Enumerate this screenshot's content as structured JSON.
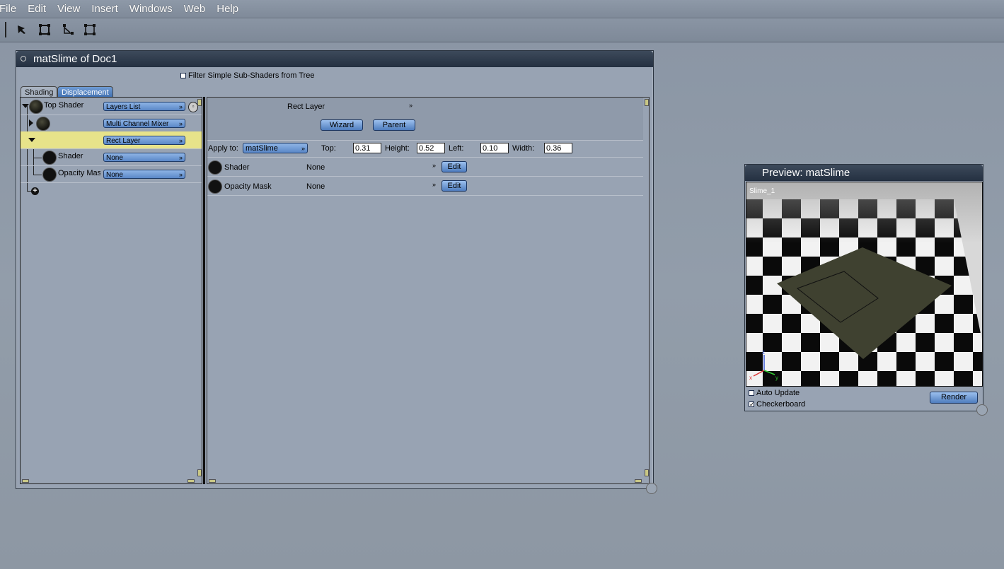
{
  "menu": [
    "File",
    "Edit",
    "View",
    "Insert",
    "Windows",
    "Web",
    "Help"
  ],
  "toolbar": {
    "tools": [
      "select-arrow-icon",
      "rectangle-select-icon",
      "lasso-icon",
      "frame-icon"
    ]
  },
  "material_window": {
    "title": "matSlime of Doc1",
    "filter_label": "Filter Simple Sub-Shaders from Tree",
    "filter_checked": false,
    "tabs": [
      "Shading",
      "Displacement"
    ],
    "active_tab": "Shading",
    "tree": {
      "rows": [
        {
          "label": "Top Shader",
          "dropdown": "Layers List"
        },
        {
          "label": "",
          "dropdown": "Multi Channel Mixer"
        },
        {
          "label": "",
          "dropdown": "Rect Layer"
        },
        {
          "label": "Shader",
          "dropdown": "None"
        },
        {
          "label": "Opacity Mask",
          "dropdown": "None"
        }
      ]
    },
    "props": {
      "layer_type": "Rect Layer",
      "wizard_label": "Wizard",
      "parent_label": "Parent",
      "apply_to_label": "Apply to:",
      "apply_to_value": "matSlime",
      "top_label": "Top:",
      "top_value": "0.31",
      "height_label": "Height:",
      "height_value": "0.52",
      "left_label": "Left:",
      "left_value": "0.10",
      "width_label": "Width:",
      "width_value": "0.36",
      "rows": [
        {
          "label": "Shader",
          "value": "None",
          "edit_label": "Edit"
        },
        {
          "label": "Opacity Mask",
          "value": "None",
          "edit_label": "Edit"
        }
      ]
    }
  },
  "preview": {
    "title": "Preview: matSlime",
    "object_label": "Slime_1",
    "auto_update_label": "Auto Update",
    "auto_update_checked": false,
    "checkerboard_label": "Checkerboard",
    "checkerboard_checked": true,
    "render_label": "Render",
    "axis_labels": [
      "x",
      "y",
      "z"
    ]
  },
  "colors": {
    "window_bg": "#98a3b3",
    "title_bar": "#2c3848",
    "selected_row": "#e7e38a",
    "button_blue": "#6f9bd4",
    "slime_color": "#3f4130"
  }
}
